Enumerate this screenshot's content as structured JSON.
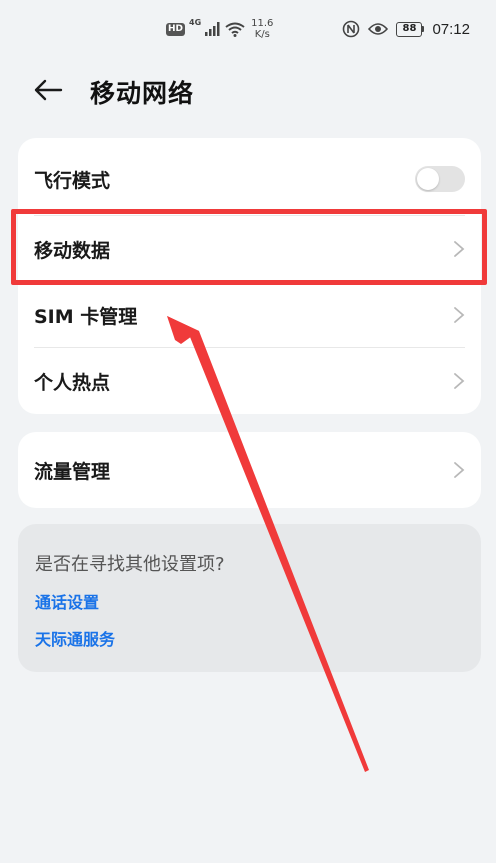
{
  "status_bar": {
    "hd": "HD",
    "network": "4G",
    "speed_value": "11.6",
    "speed_unit": "K/s",
    "battery": "88",
    "time": "07:12"
  },
  "header": {
    "title": "移动网络"
  },
  "settings_list": [
    {
      "label": "飞行模式",
      "control": "toggle",
      "enabled": false
    },
    {
      "label": "移动数据",
      "control": "chevron"
    },
    {
      "label": "SIM 卡管理",
      "control": "chevron"
    },
    {
      "label": "个人热点",
      "control": "chevron"
    }
  ],
  "traffic": {
    "label": "流量管理"
  },
  "suggestions": {
    "question": "是否在寻找其他设置项?",
    "links": [
      "通话设置",
      "天际通服务"
    ]
  },
  "colors": {
    "accent_link": "#1a73e8",
    "highlight": "#f03a3a",
    "background": "#f1f3f5"
  }
}
